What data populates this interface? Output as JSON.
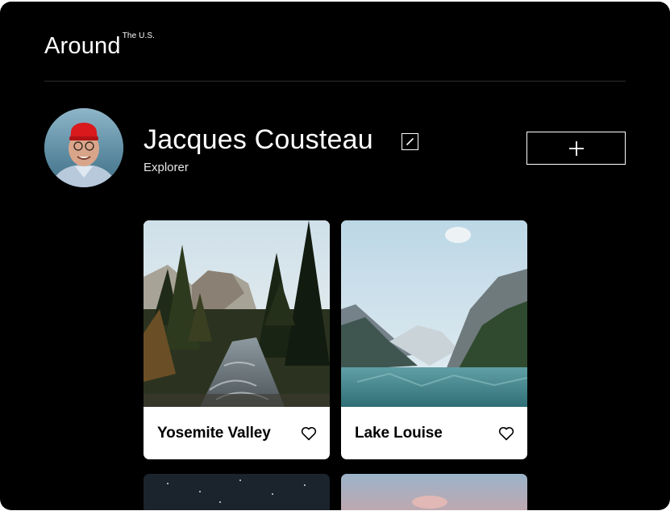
{
  "header": {
    "logo": "Around",
    "logo_superscript": "The U.S."
  },
  "profile": {
    "name": "Jacques Cousteau",
    "title": "Explorer",
    "edit_icon": "pencil-icon",
    "add_icon": "plus-icon"
  },
  "cards": [
    {
      "name": "Yosemite Valley",
      "liked": false,
      "like_icon": "heart-outline-icon"
    },
    {
      "name": "Lake Louise",
      "liked": false,
      "like_icon": "heart-outline-icon"
    }
  ],
  "colors": {
    "background": "#000000",
    "card": "#ffffff",
    "text": "#ffffff",
    "divider": "#2d2d2d"
  }
}
